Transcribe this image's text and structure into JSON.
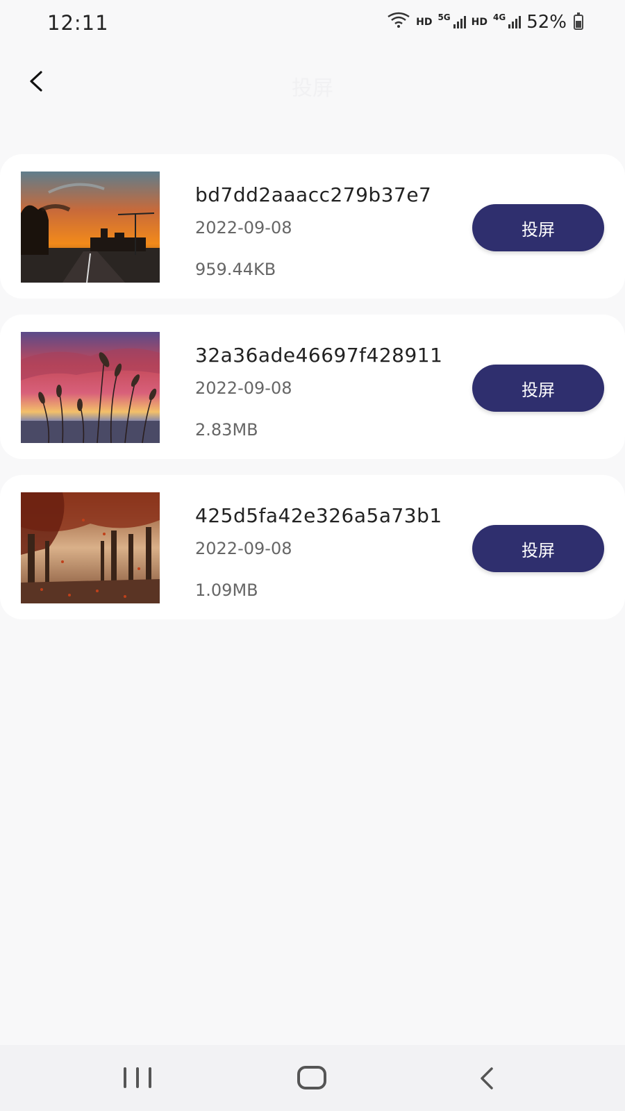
{
  "status_bar": {
    "time": "12:11",
    "hd1": "HD",
    "net1": "5G",
    "hd2": "HD",
    "net2": "4G",
    "battery": "52%"
  },
  "app_bar": {
    "back_icon": "chevron-left-icon",
    "title": "投屏"
  },
  "items": [
    {
      "name": "bd7dd2aaacc279b37e7",
      "date": "2022-09-08",
      "size": "959.44KB",
      "button": "投屏",
      "thumbnail": "sunset-road-image"
    },
    {
      "name": "32a36ade46697f428911",
      "date": "2022-09-08",
      "size": "2.83MB",
      "button": "投屏",
      "thumbnail": "reeds-sunset-image"
    },
    {
      "name": "425d5fa42e326a5a73b1",
      "date": "2022-09-08",
      "size": "1.09MB",
      "button": "投屏",
      "thumbnail": "autumn-trees-image"
    }
  ],
  "nav_bar": {
    "recents_icon": "recents-icon",
    "home_icon": "home-icon",
    "back_icon": "back-icon"
  },
  "colors": {
    "background": "#f8f8f9",
    "card": "#ffffff",
    "button": "#2f2f6e",
    "button_text": "#ffffff"
  }
}
